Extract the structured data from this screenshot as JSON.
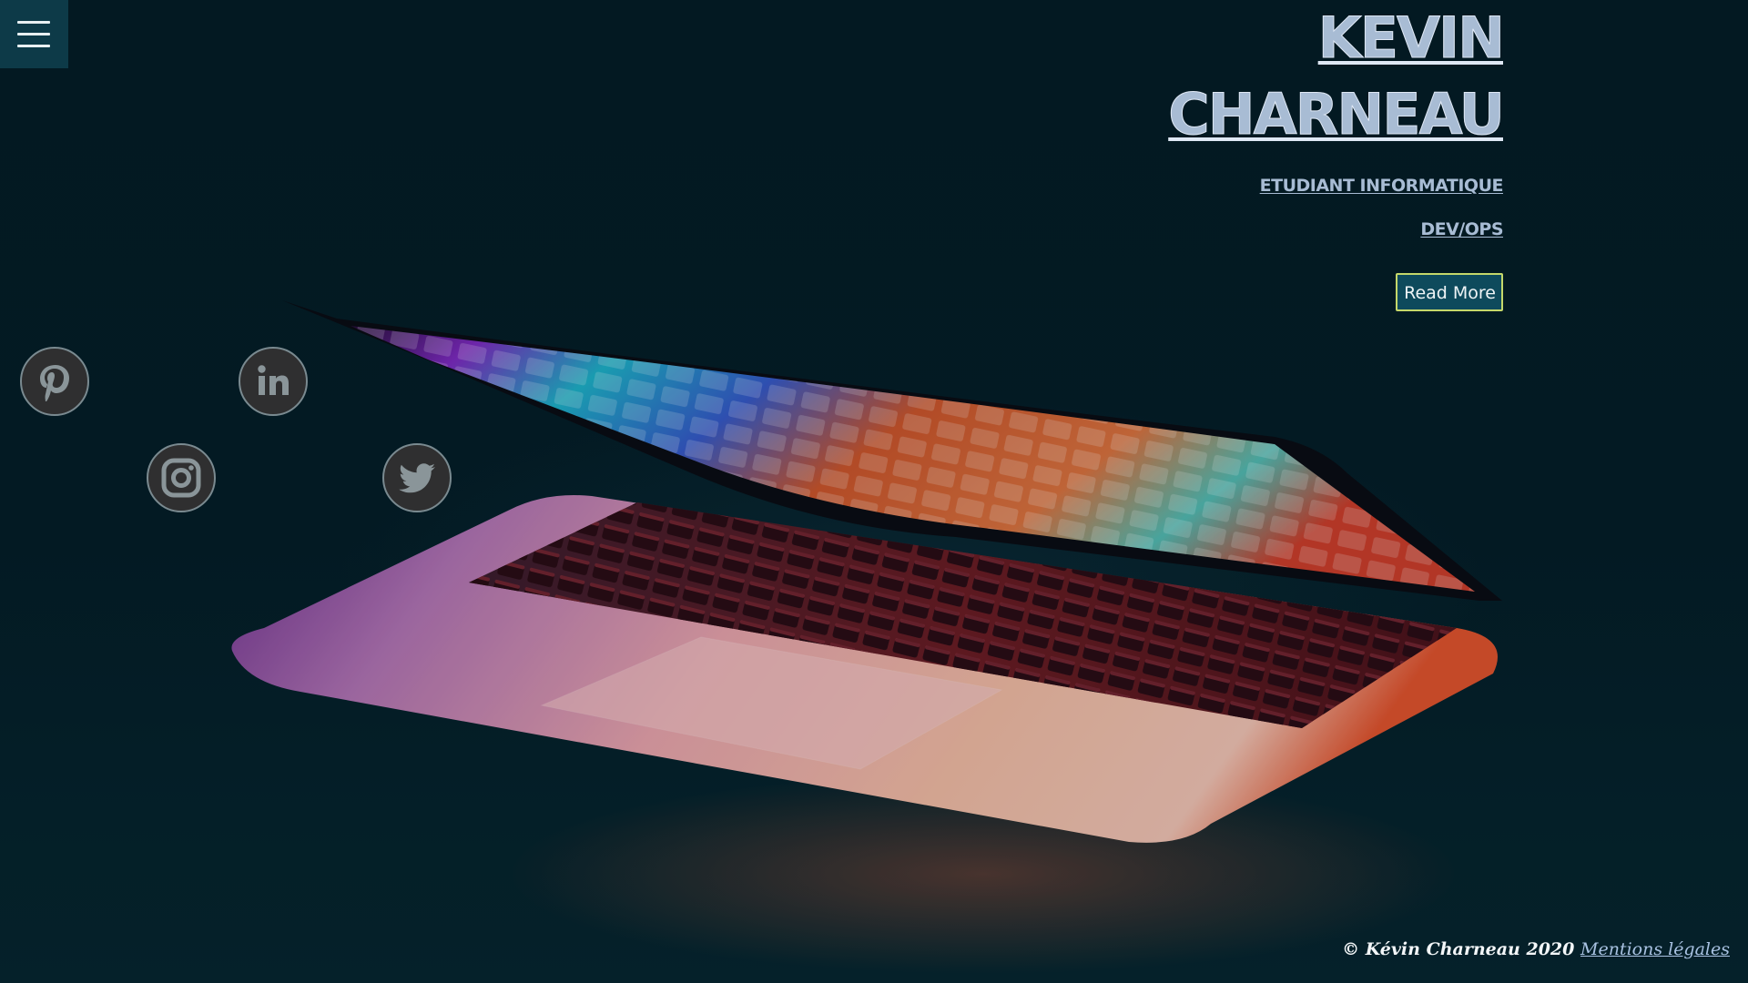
{
  "menu": {
    "icon": "hamburger-menu-icon"
  },
  "hero": {
    "name_line1": "KEVIN",
    "name_line2": "CHARNEAU",
    "subtitle1": "ETUDIANT INFORMATIQUE",
    "subtitle2": "DEV/OPS",
    "read_more_label": "Read More"
  },
  "social": [
    {
      "icon": "pinterest-icon"
    },
    {
      "icon": "linkedin-icon"
    },
    {
      "icon": "instagram-icon"
    },
    {
      "icon": "twitter-icon"
    }
  ],
  "footer": {
    "copyright": "© Kévin Charneau 2020",
    "legal_link": "Mentions légales"
  },
  "colors": {
    "background": "#041a22",
    "menu_bg": "#0d3a48",
    "title": "#a8bcd4",
    "button_bg": "#0e4a5c",
    "button_border": "#c5d86a",
    "link": "#a9c2e2"
  }
}
